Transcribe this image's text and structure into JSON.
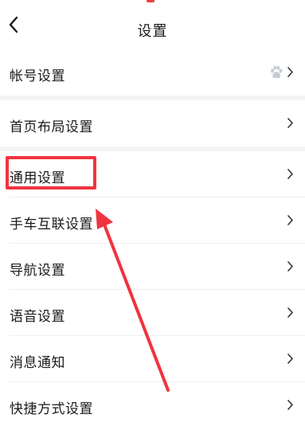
{
  "header": {
    "title": "设置"
  },
  "settings": {
    "account": "帐号设置",
    "home_layout": "首页布局设置",
    "general": "通用设置",
    "car_link": "手车互联设置",
    "navigation": "导航设置",
    "voice": "语音设置",
    "notifications": "消息通知",
    "shortcuts": "快捷方式设置"
  },
  "icons": {
    "back": "chevron-left-icon",
    "row_arrow": "chevron-right-icon",
    "account_badge": "paw-icon"
  },
  "colors": {
    "annotation": "#f0343f",
    "section_gap": "#f4f4f4",
    "paw_icon": "#c7ccd3"
  }
}
